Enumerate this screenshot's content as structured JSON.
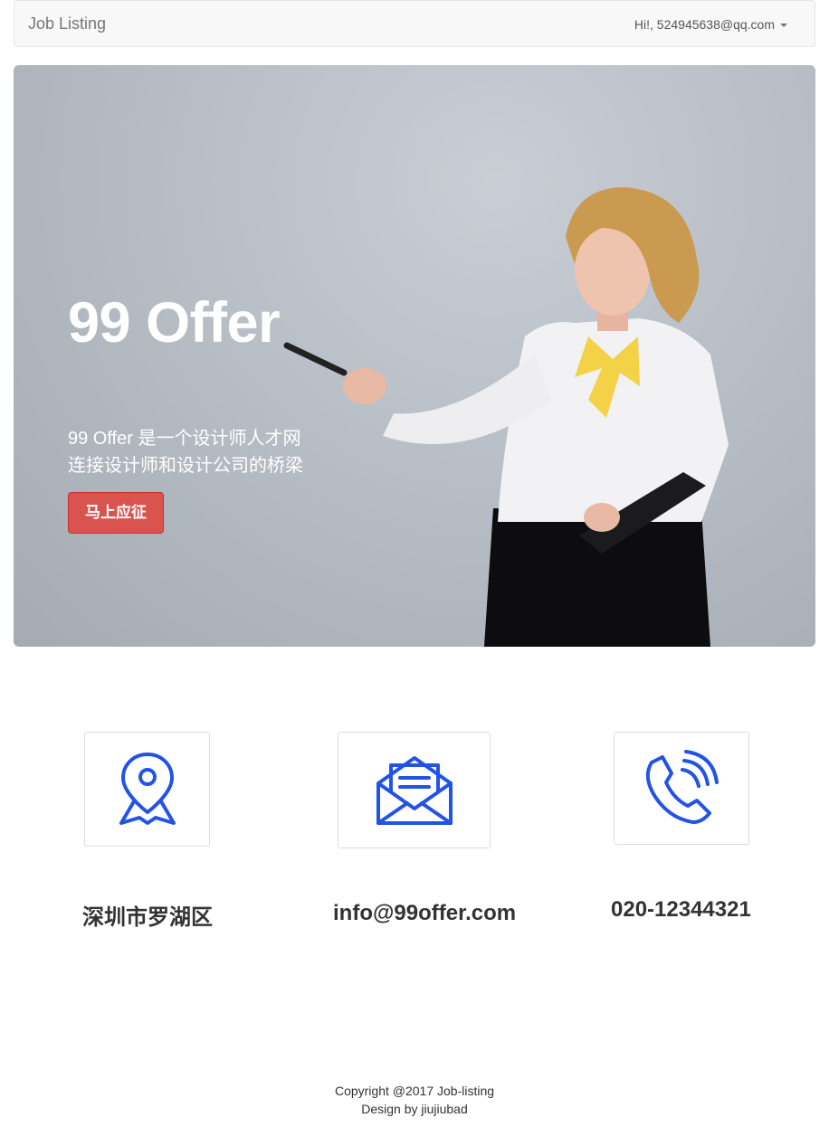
{
  "navbar": {
    "brand": "Job Listing",
    "user_greeting": "Hi!, 524945638@qq.com"
  },
  "hero": {
    "title": "99 Offer",
    "subtitle_line1": "99 Offer 是一个设计师人才网",
    "subtitle_line2": "连接设计师和设计公司的桥梁",
    "apply_button": "马上应征"
  },
  "contacts": [
    {
      "icon": "location-pin-icon",
      "text": "深圳市罗湖区"
    },
    {
      "icon": "envelope-icon",
      "text": "info@99offer.com"
    },
    {
      "icon": "phone-icon",
      "text": "020-12344321"
    }
  ],
  "colors": {
    "icon_blue": "#2353e6",
    "apply_red": "#d9534f"
  },
  "footer": {
    "copyright": "Copyright @2017 Job-listing",
    "design": "Design by jiujiubad"
  }
}
